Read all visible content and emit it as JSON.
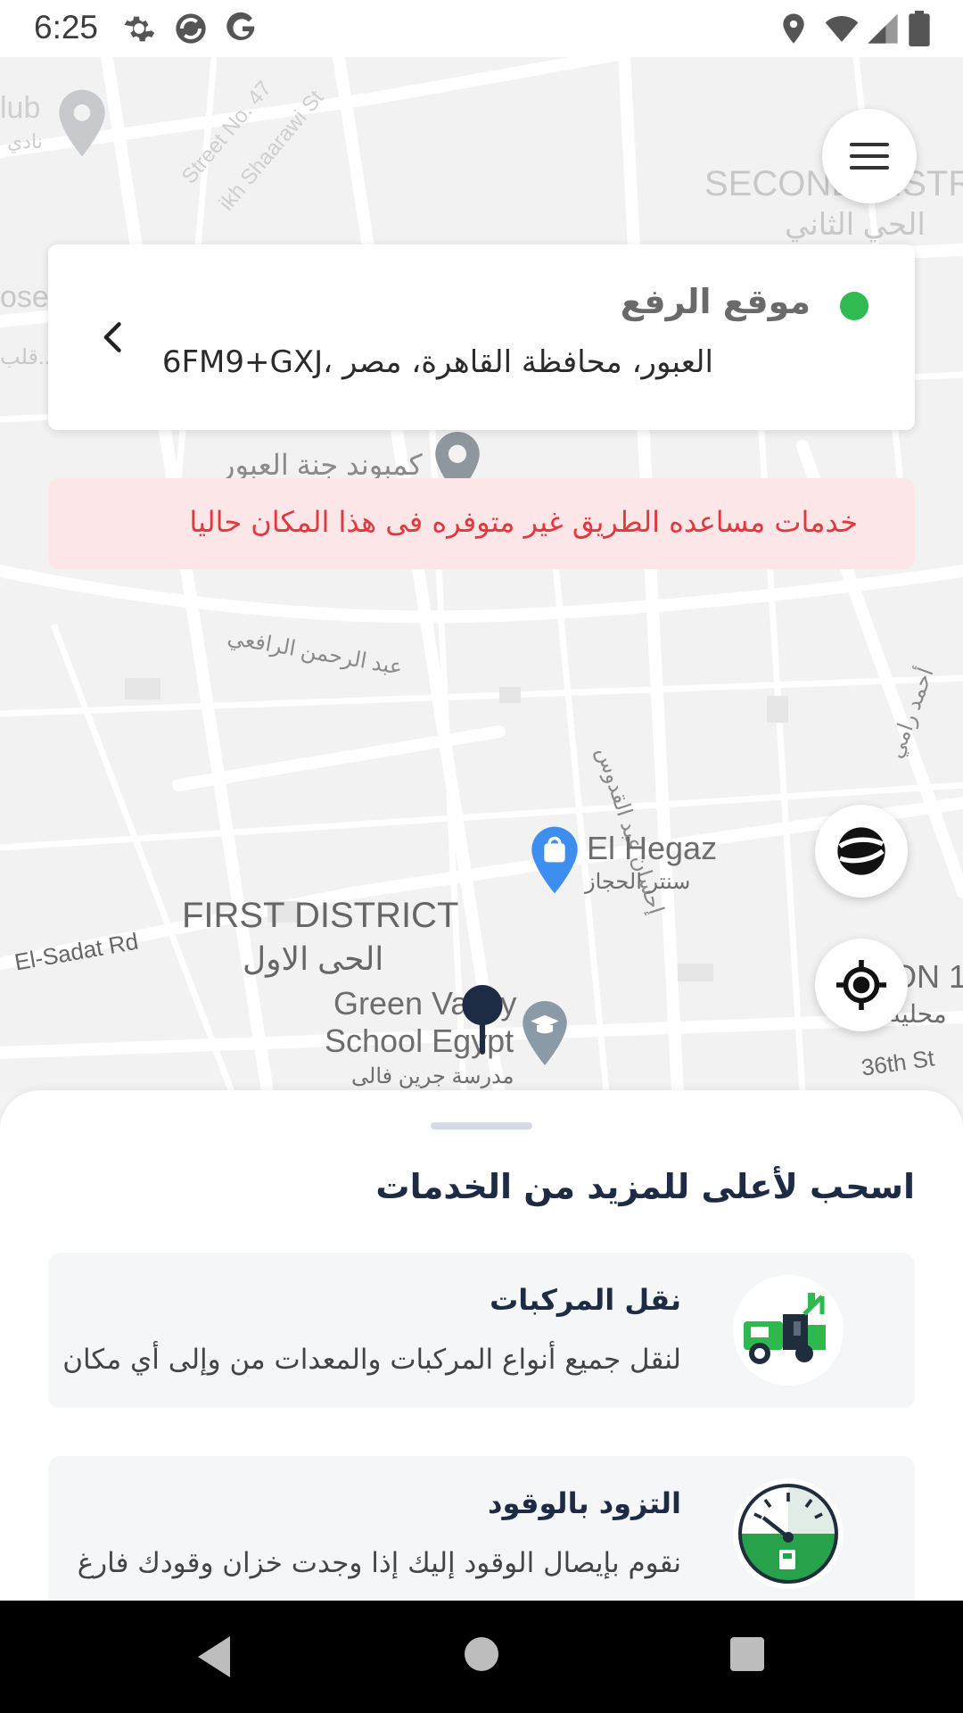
{
  "status_bar": {
    "time": "6:25",
    "left_icons": [
      "gear-icon",
      "sync-icon",
      "google-icon"
    ],
    "right_icons": [
      "location-icon",
      "wifi-icon",
      "signal-icon",
      "battery-icon"
    ]
  },
  "map": {
    "labels": {
      "club": "lub",
      "club_ar": "نادي",
      "street47": "Street No. 47",
      "shaarawi": "ikh Shaarawi St",
      "second_district": "SECOND DISTR",
      "second_district_ar": "الحي الثاني",
      "osep": "osep",
      "qalb": "قلب...",
      "compound": "كمبوند جنة العبور",
      "abdelrahman": "عبد الرحمن الرافعي",
      "ehsan": "إحسان عبد القدوس",
      "ahmed": "أحمد رامي",
      "hegaz": "El Hegaz",
      "hegaz_ar": "سنتر الحجاز",
      "first_district": "FIRST DISTRICT",
      "first_district_ar": "الحى الاول",
      "sadat": "El-Sadat Rd",
      "green_valley_1": "Green Valley",
      "green_valley_2": "School Egypt",
      "green_valley_ar": "مدرسة جرين فالى",
      "on1": "ON 1",
      "mahalia": "محلية",
      "st36": "36th St"
    }
  },
  "pickup_card": {
    "title": "موقع الرفع",
    "address": "العبور، محافظة القاهرة، مصر ،6FM9+GXJ"
  },
  "warning": {
    "text": "خدمات مساعده الطريق غير متوفره فى هذا المكان حاليا"
  },
  "sheet": {
    "title": "اسحب لأعلى للمزيد من الخدمات",
    "services": [
      {
        "title": "نقل المركبات",
        "description": "لنقل جميع أنواع المركبات والمعدات من وإلى أي مكان",
        "icon": "tow-truck-icon"
      },
      {
        "title": "التزود بالوقود",
        "description": "نقوم بإيصال الوقود إليك إذا وجدت خزان وقودك فارغ",
        "icon": "fuel-gauge-icon"
      }
    ]
  },
  "colors": {
    "accent_green": "#2fba52",
    "warning_bg": "#fde6e7",
    "warning_text": "#e0393f",
    "navy": "#1d2b44"
  }
}
